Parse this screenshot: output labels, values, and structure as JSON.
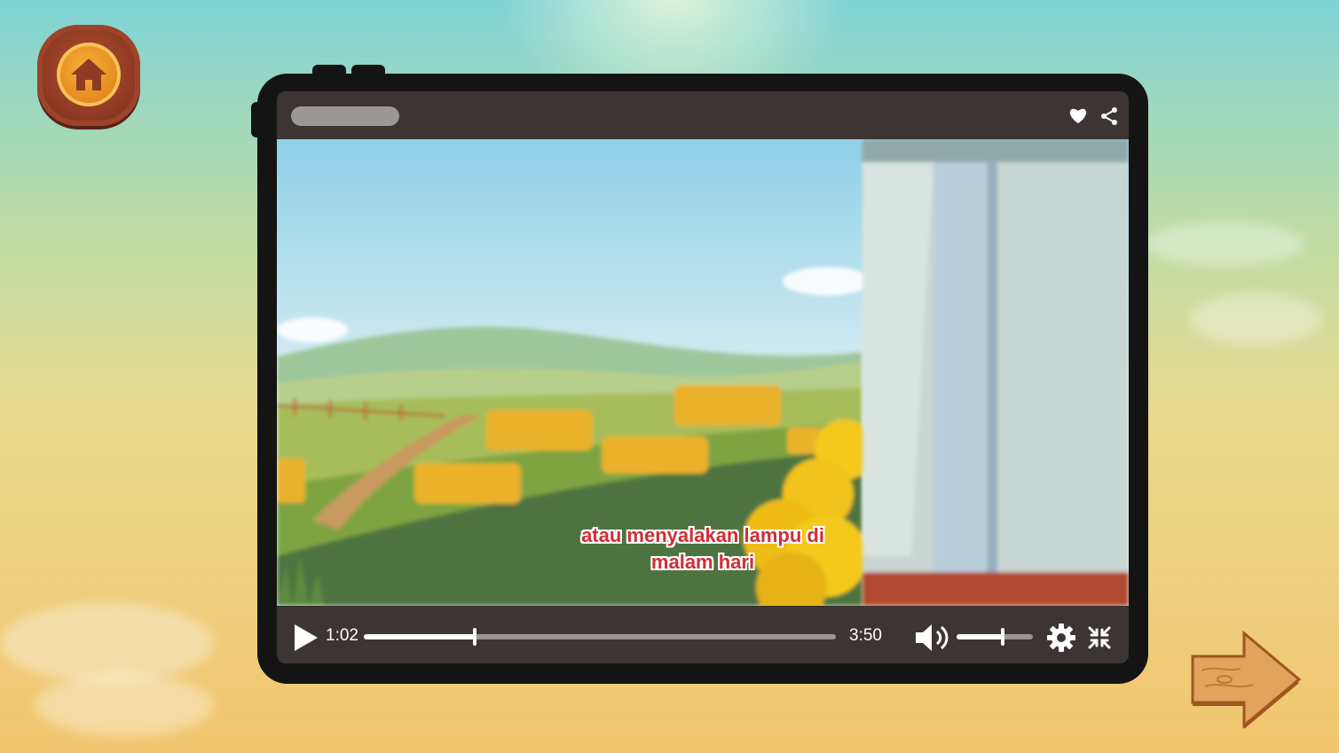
{
  "app": {
    "home_icon": "home-icon",
    "next_icon": "arrow-right-icon"
  },
  "player": {
    "title": "",
    "favorite_icon": "heart-icon",
    "share_icon": "share-icon",
    "subtitle_line1": "atau menyalakan lampu di",
    "subtitle_line2": "malam hari",
    "current_time": "1:02",
    "duration": "3:50",
    "progress": 0.235,
    "volume": 0.6,
    "play_icon": "play-icon",
    "volume_icon": "volume-icon",
    "settings_icon": "gear-icon",
    "exit_fullscreen_icon": "exit-fullscreen-icon"
  },
  "colors": {
    "frame": "#141414",
    "bar": "#3d3434",
    "subtitle": "#d02e36",
    "track": "#9a9494"
  }
}
